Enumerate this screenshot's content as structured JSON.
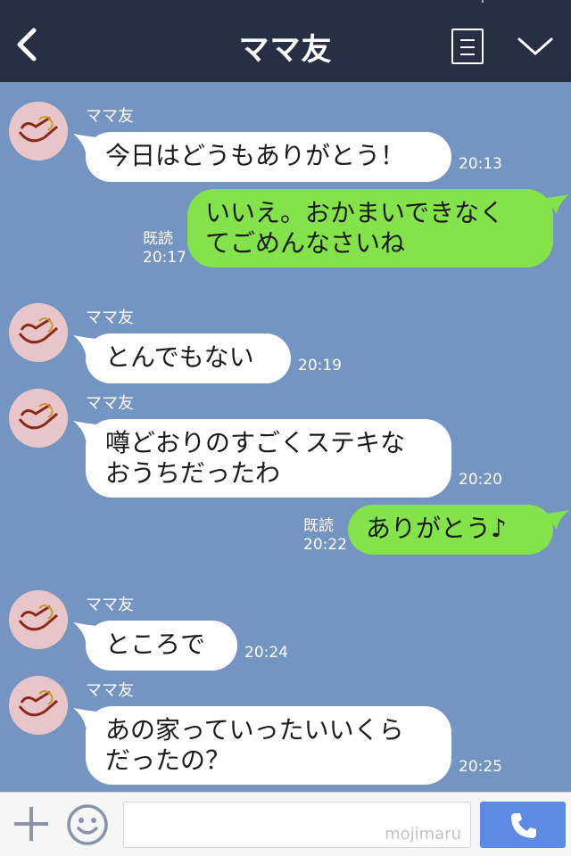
{
  "header": {
    "title": "ママ友"
  },
  "messages": [
    {
      "sender": "ママ友",
      "text": "今日はどうもありがとう！",
      "time": "20:13"
    },
    {
      "text_lines": [
        "いいえ。おかまいできなく",
        "てごめんなさいね"
      ],
      "read": "既読",
      "time": "20:17"
    },
    {
      "sender": "ママ友",
      "text": "とんでもない",
      "time": "20:19"
    },
    {
      "sender": "ママ友",
      "text_lines": [
        "噂どおりのすごくステキな",
        "おうちだったわ"
      ],
      "time": "20:20"
    },
    {
      "text": "ありがとう♪",
      "read": "既読",
      "time": "20:22"
    },
    {
      "sender": "ママ友",
      "text": "ところで",
      "time": "20:24"
    },
    {
      "sender": "ママ友",
      "text_lines": [
        "あの家っていったいいくら",
        "だったの？"
      ],
      "time": "20:25"
    }
  ],
  "input": {
    "value": "",
    "watermark": "mojimaru"
  },
  "colors": {
    "header": "#262f44",
    "chat_bg": "#7494c2",
    "outgoing": "#84e34b",
    "send": "#5d8be3"
  },
  "icons": [
    "back-icon",
    "menu-icon",
    "chevron-down-icon",
    "plus-icon",
    "smile-icon",
    "phone-icon"
  ]
}
